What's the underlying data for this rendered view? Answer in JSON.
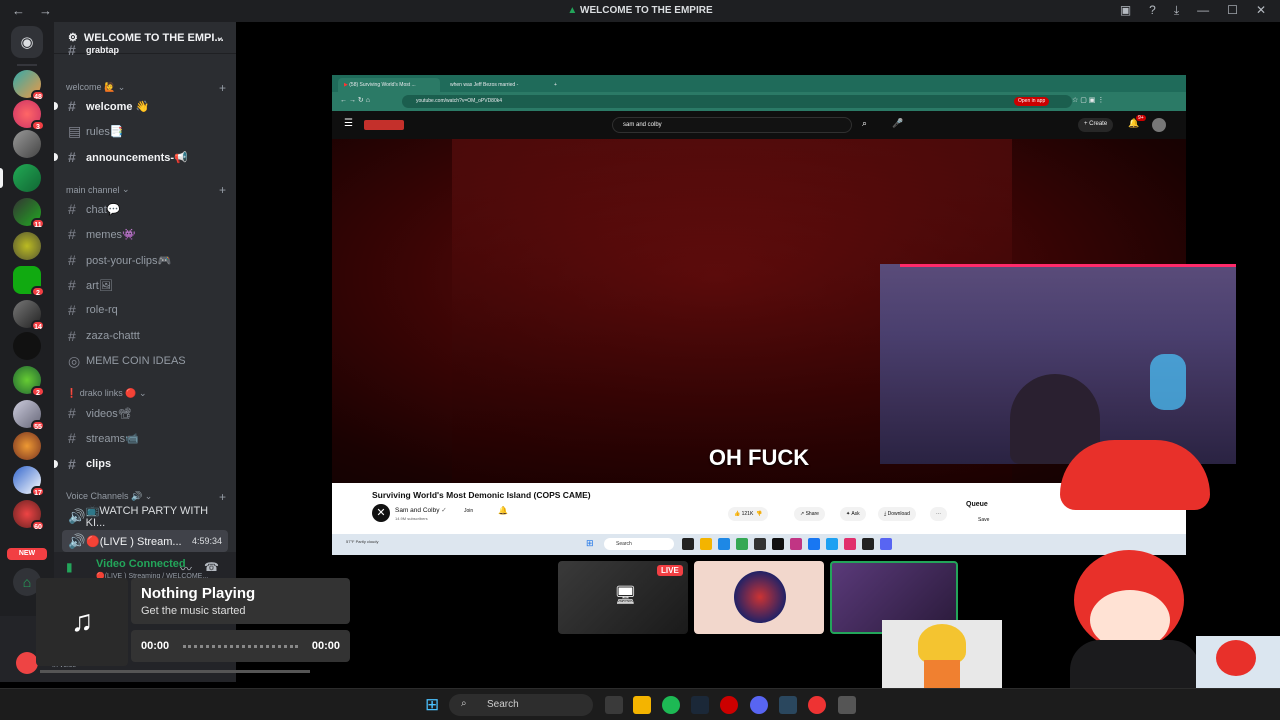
{
  "window": {
    "title": "WELCOME TO THE EMPIRE"
  },
  "server_rail": {
    "badges": [
      "48",
      "3",
      "11",
      "2",
      "14",
      "2",
      "55",
      "17",
      "60"
    ],
    "new_label": "NEW"
  },
  "sidebar": {
    "server_name": "WELCOME TO THE EMPI...",
    "top_partial_channel": "grabtap",
    "categories": {
      "welcome": "welcome 🙋",
      "main": "main channel",
      "drako": "❗ drako links 🔴",
      "voice": "Voice Channels 🔊"
    },
    "channels": {
      "welcome": "welcome 👋",
      "rules": "rules📑",
      "announcements": "announcements-📢",
      "chat": "chat💬",
      "memes": "memes👾",
      "post_clips": "post-your-clips🎮",
      "art": "art🖼",
      "role_rq": "role-rq",
      "zaza": "zaza-chattt",
      "meme_coin": "MEME COIN IDEAS",
      "videos": "videos📽",
      "streams": "streams📹",
      "clips": "clips",
      "watch_party": "📺WATCH PARTY WITH KI...",
      "live_stream": "🔴(LIVE ) Stream...",
      "live_time": "4:59:34"
    }
  },
  "voice_panel": {
    "status": "Video Connected",
    "sub": "🔴(LIVE ) Streaming / WELCOME...",
    "in_voice": "In voice"
  },
  "now_playing": {
    "title": "Nothing Playing",
    "subtitle": "Get the music started",
    "time_start": "00:00",
    "time_end": "00:00"
  },
  "browser": {
    "tab1": "(58) Surviving World's Most ...",
    "tab2": "when was Jeff Bezos married -",
    "url": "youtube.com/watch?v=OM_oPVD80k4",
    "open_in_app": "Open in app",
    "search_query": "sam and colby",
    "create_label": "Create",
    "notif_count": "9+",
    "caption": "OH FUCK",
    "video_title": "Surviving World's Most Demonic Island (COPS CAME)",
    "channel_name": "Sam and Colby",
    "subscribers": "14.9M subscribers",
    "join_label": "Join",
    "likes": "121K",
    "share_label": "Share",
    "ask_label": "Ask",
    "download_label": "Download",
    "queue_label": "Queue",
    "save_label": "Save",
    "weather": "57°F Partly cloudy",
    "inner_search": "Search"
  },
  "streams": {
    "live_label": "LIVE"
  },
  "taskbar": {
    "search_label": "Search"
  },
  "colors": {
    "discord_bg": "#2b2d31",
    "rail_bg": "#1e1f22",
    "voice_green": "#23a55a",
    "badge_red": "#f23f43",
    "browser_tab": "#1f6b5a"
  }
}
